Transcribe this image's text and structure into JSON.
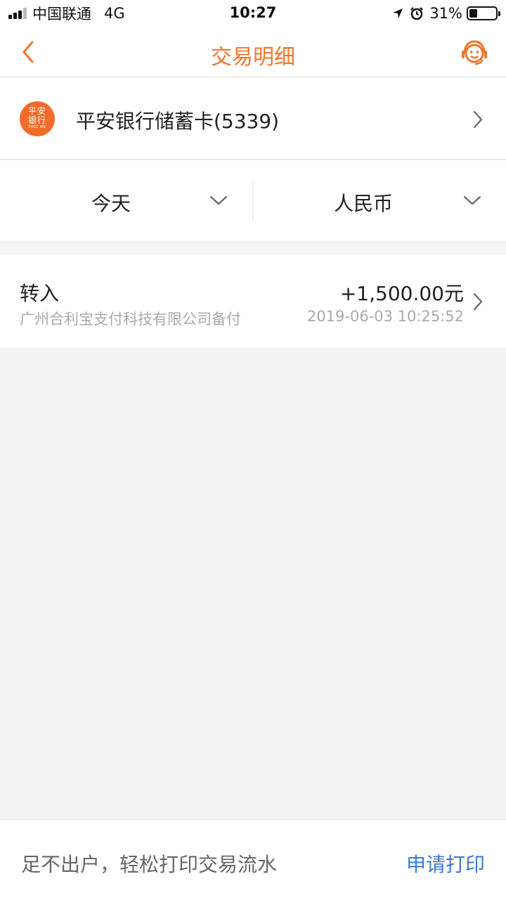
{
  "status_bar": {
    "carrier": "中国联通",
    "network": "4G",
    "time": "10:27",
    "battery": "31%",
    "battery_level": 0.31
  },
  "nav": {
    "title": "交易明细",
    "back_icon": "chevron-left-icon",
    "service_icon": "customer-service-icon",
    "accent_color": "#f0762a"
  },
  "account": {
    "logo_line1": "平安",
    "logo_line2": "银行",
    "logo_line3": "PING AN",
    "name": "平安银行储蓄卡(5339)"
  },
  "filters": {
    "date": "今天",
    "currency": "人民币"
  },
  "transactions": [
    {
      "type": "转入",
      "description": "广州合利宝支付科技有限公司备付",
      "amount": "+1,500.00元",
      "time": "2019-06-03 10:25:52"
    }
  ],
  "footer": {
    "text": "足不出户，轻松打印交易流水",
    "action": "申请打印",
    "action_color": "#3b7ad8"
  }
}
